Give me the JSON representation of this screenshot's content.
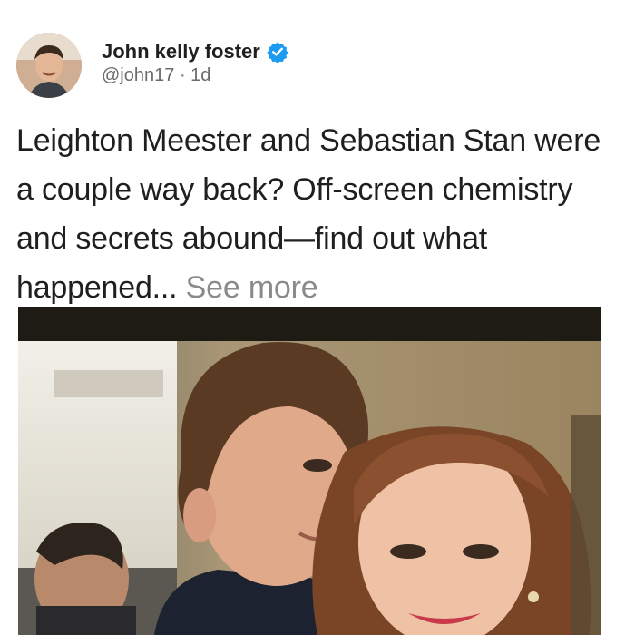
{
  "post": {
    "author": {
      "name": "John kelly foster",
      "handle": "@john17",
      "separator": "·",
      "time": "1d",
      "verified": true,
      "verified_color": "#1d9bf0",
      "avatar_icon": "profile-photo"
    },
    "text": "Leighton Meester and Sebastian Stan were a couple way back? Off-screen chemistry and secrets abound—find out what happened...",
    "see_more": "See more",
    "media": {
      "type": "photo",
      "icon": "photo-image"
    }
  }
}
